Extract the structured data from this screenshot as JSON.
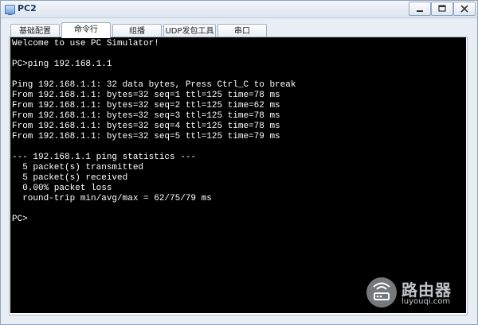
{
  "window": {
    "title": "PC2",
    "controls": {
      "minimize": "minimize-icon",
      "maximize": "maximize-icon",
      "close": "close-icon"
    }
  },
  "tabs": [
    {
      "label": "基础配置",
      "active": false
    },
    {
      "label": "命令行",
      "active": true
    },
    {
      "label": "组播",
      "active": false
    },
    {
      "label": "UDP发包工具",
      "active": false
    },
    {
      "label": "串口",
      "active": false
    }
  ],
  "terminal": {
    "background": "#000000",
    "foreground": "#ffffff",
    "lines": [
      "Welcome to use PC Simulator!",
      "",
      "PC>ping 192.168.1.1",
      "",
      "Ping 192.168.1.1: 32 data bytes, Press Ctrl_C to break",
      "From 192.168.1.1: bytes=32 seq=1 ttl=125 time=78 ms",
      "From 192.168.1.1: bytes=32 seq=2 ttl=125 time=62 ms",
      "From 192.168.1.1: bytes=32 seq=3 ttl=125 time=78 ms",
      "From 192.168.1.1: bytes=32 seq=4 ttl=125 time=78 ms",
      "From 192.168.1.1: bytes=32 seq=5 ttl=125 time=79 ms",
      "",
      "--- 192.168.1.1 ping statistics ---",
      "  5 packet(s) transmitted",
      "  5 packet(s) received",
      "  0.00% packet loss",
      "  round-trip min/avg/max = 62/75/79 ms",
      "",
      "PC>"
    ]
  },
  "watermark": {
    "title": "路由器",
    "subtitle": "luyouqi.com",
    "icon": "router-logo-icon"
  }
}
